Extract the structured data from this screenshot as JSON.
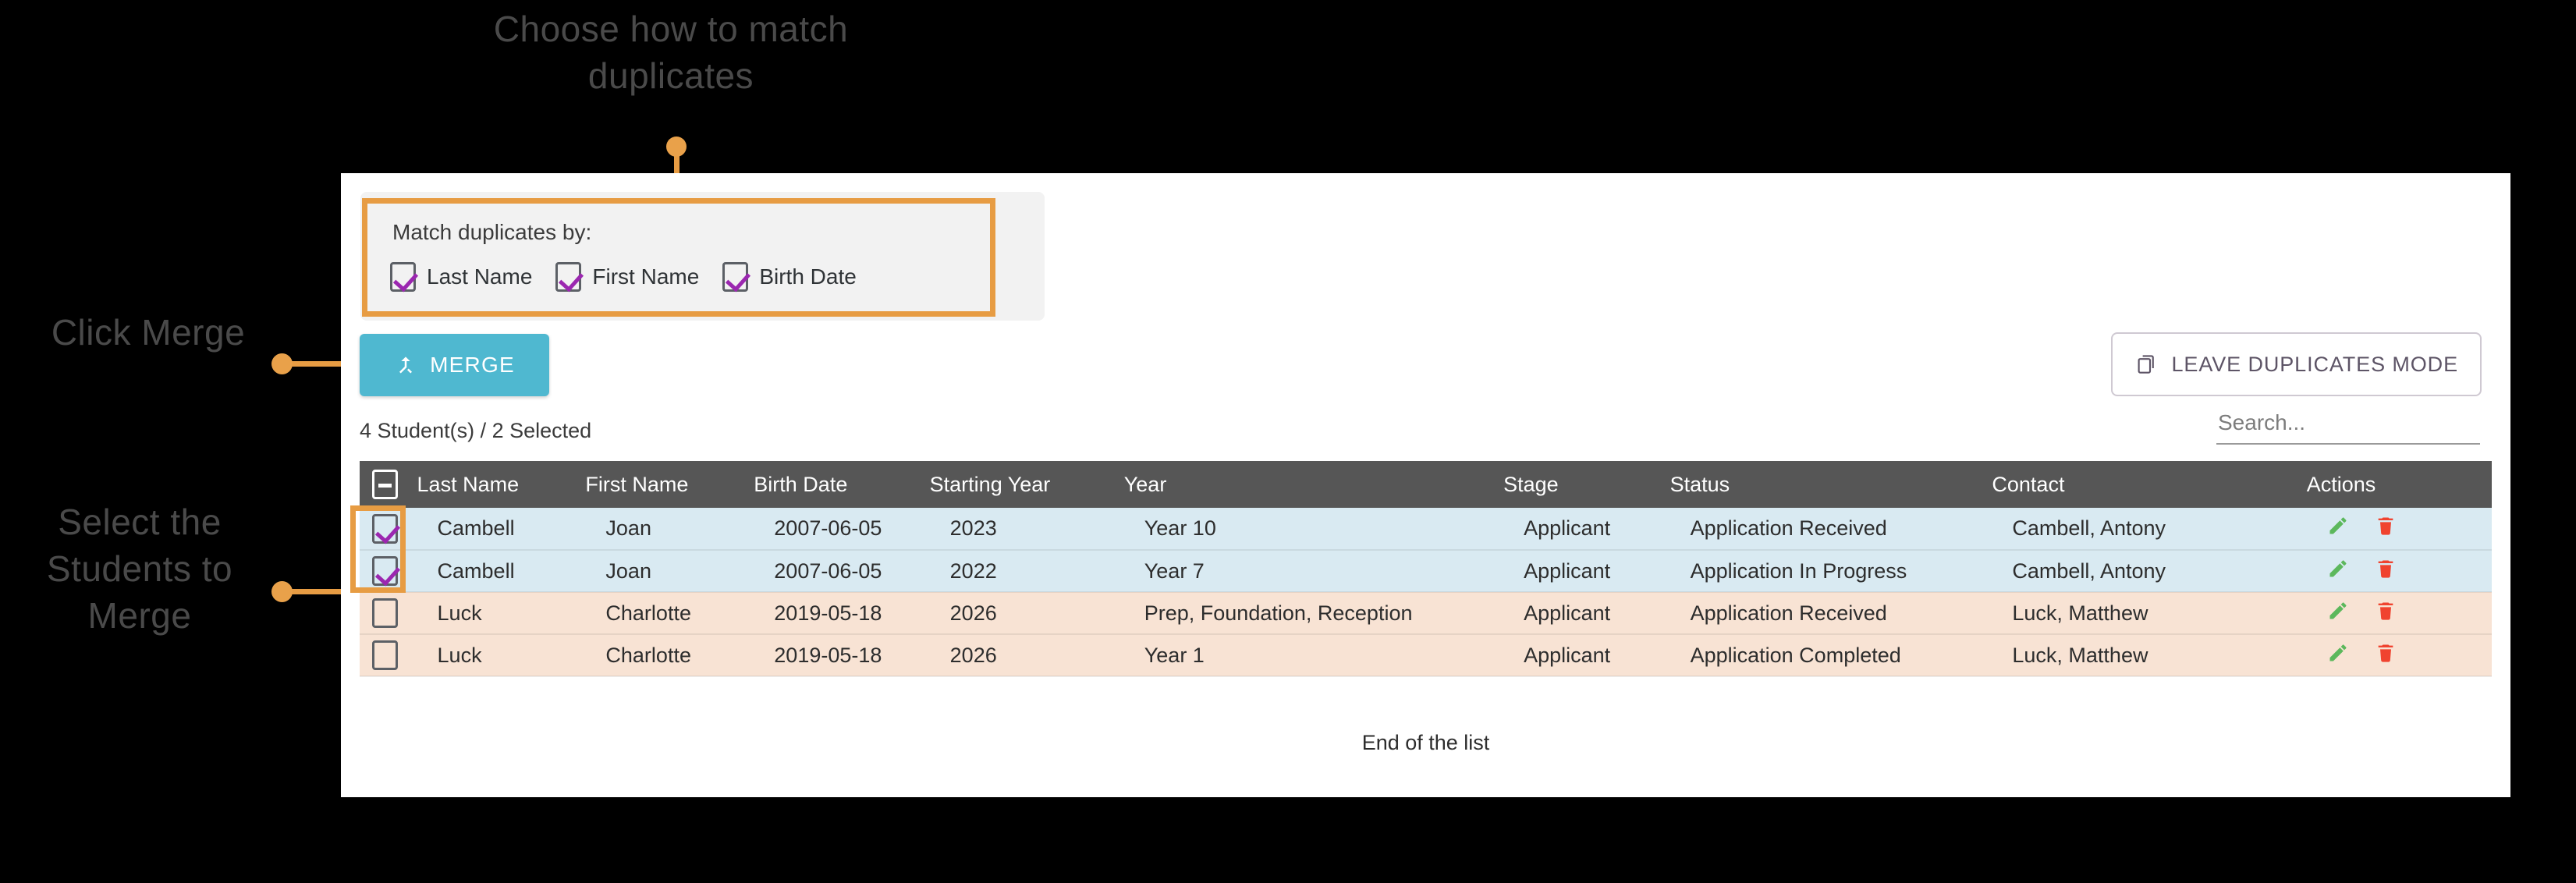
{
  "annotations": {
    "top": "Choose how to match duplicates",
    "middle": "Click Merge",
    "bottom": "Select the Students to Merge"
  },
  "match_panel": {
    "label": "Match duplicates by:",
    "options": [
      {
        "label": "Last Name",
        "checked": true
      },
      {
        "label": "First Name",
        "checked": true
      },
      {
        "label": "Birth Date",
        "checked": true
      }
    ]
  },
  "toolbar": {
    "merge_label": "MERGE",
    "merge_icon": "call-merge-icon",
    "leave_label": "LEAVE DUPLICATES MODE",
    "leave_icon": "copy-icon",
    "merge_button_color": "#4fb8d0",
    "highlight_color": "#e79c43"
  },
  "count_text": "4 Student(s) / 2 Selected",
  "search": {
    "placeholder": "Search...",
    "value": ""
  },
  "table": {
    "columns": [
      "Last Name",
      "First Name",
      "Birth Date",
      "Starting Year",
      "Year",
      "Stage",
      "Status",
      "Contact",
      "Actions"
    ],
    "select_all_state": "indeterminate",
    "rows": [
      {
        "selected": true,
        "group": "duplicate",
        "last_name": "Cambell",
        "first_name": "Joan",
        "birth_date": "2007-06-05",
        "starting_year": "2023",
        "year": "Year 10",
        "stage": "Applicant",
        "status": "Application Received",
        "contact": "Cambell, Antony"
      },
      {
        "selected": true,
        "group": "duplicate",
        "last_name": "Cambell",
        "first_name": "Joan",
        "birth_date": "2007-06-05",
        "starting_year": "2022",
        "year": "Year 7",
        "stage": "Applicant",
        "status": "Application In Progress",
        "contact": "Cambell, Antony"
      },
      {
        "selected": false,
        "group": "alternate",
        "last_name": "Luck",
        "first_name": "Charlotte",
        "birth_date": "2019-05-18",
        "starting_year": "2026",
        "year": "Prep, Foundation, Reception",
        "stage": "Applicant",
        "status": "Application Received",
        "contact": "Luck, Matthew"
      },
      {
        "selected": false,
        "group": "alternate",
        "last_name": "Luck",
        "first_name": "Charlotte",
        "birth_date": "2019-05-18",
        "starting_year": "2026",
        "year": "Year 1",
        "stage": "Applicant",
        "status": "Application Completed",
        "contact": "Luck, Matthew"
      }
    ],
    "row_actions": [
      {
        "name": "edit-icon",
        "color": "#5cb85c"
      },
      {
        "name": "delete-icon",
        "color": "#f0432f"
      }
    ]
  },
  "footer": {
    "end_of_list": "End of the list"
  }
}
